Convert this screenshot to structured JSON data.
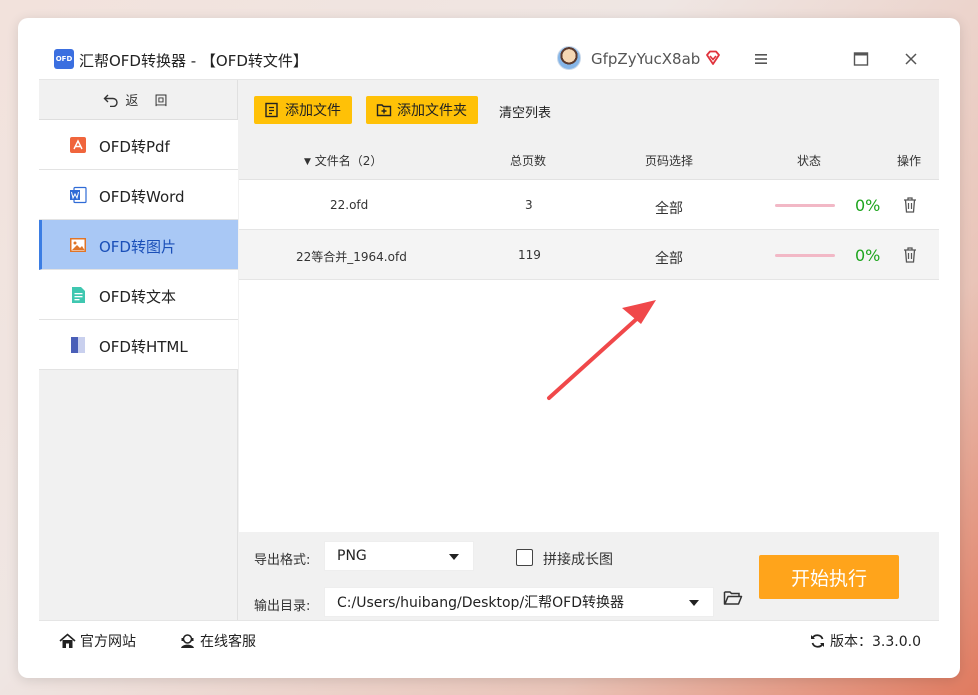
{
  "window": {
    "logo_text": "OFD",
    "title": "汇帮OFD转换器 - 【OFD转文件】",
    "username": "GfpZyYucX8ab"
  },
  "sidebar": {
    "back_label": "返 回",
    "items": [
      {
        "label": "OFD转Pdf",
        "icon": "pdf-icon",
        "color": "#f0653c"
      },
      {
        "label": "OFD转Word",
        "icon": "word-icon",
        "color": "#2f6bd6"
      },
      {
        "label": "OFD转图片",
        "icon": "image-icon",
        "color": "#e07528",
        "active": true
      },
      {
        "label": "OFD转文本",
        "icon": "text-icon",
        "color": "#3fc7b0"
      },
      {
        "label": "OFD转HTML",
        "icon": "html-icon",
        "color": "#4a5fb8"
      }
    ]
  },
  "toolbar": {
    "add_file": "添加文件",
    "add_folder": "添加文件夹",
    "clear_list": "清空列表"
  },
  "table": {
    "headers": {
      "filename": "文件名（2）",
      "pages": "总页数",
      "page_select": "页码选择",
      "status": "状态",
      "action": "操作"
    },
    "rows": [
      {
        "filename": "22.ofd",
        "pages": "3",
        "page_select": "全部",
        "progress": "0%"
      },
      {
        "filename": "22等合并_1964.ofd",
        "pages": "119",
        "page_select": "全部",
        "progress": "0%"
      }
    ]
  },
  "bottom": {
    "export_format_label": "导出格式:",
    "export_format_value": "PNG",
    "stitch_label": "拼接成长图",
    "stitch_checked": false,
    "output_dir_label": "输出目录:",
    "output_dir_value": "C:/Users/huibang/Desktop/汇帮OFD转换器",
    "start_button": "开始执行"
  },
  "footer": {
    "website": "官方网站",
    "support": "在线客服",
    "version": "版本：3.3.0.0"
  },
  "colors": {
    "accent_yellow": "#ffc107",
    "start_orange": "#ffa41b",
    "active_nav": "#a9c8f5",
    "progress_green": "#1ea51e",
    "annotation_arrow": "#f0484a"
  }
}
